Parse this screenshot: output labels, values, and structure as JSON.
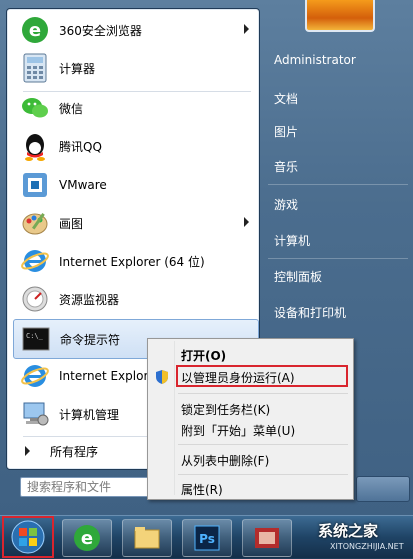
{
  "programs": [
    {
      "label": "360安全浏览器",
      "icon": "360-browser-icon",
      "has_arrow": true
    },
    {
      "label": "计算器",
      "icon": "calculator-icon",
      "has_arrow": false
    },
    {
      "label": "微信",
      "icon": "wechat-icon",
      "has_arrow": false
    },
    {
      "label": "腾讯QQ",
      "icon": "qq-icon",
      "has_arrow": false
    },
    {
      "label": "VMware",
      "icon": "vmware-icon",
      "has_arrow": false
    },
    {
      "label": "画图",
      "icon": "paint-icon",
      "has_arrow": true
    },
    {
      "label": "Internet Explorer (64 位)",
      "icon": "ie-icon",
      "has_arrow": false
    },
    {
      "label": "资源监视器",
      "icon": "resource-monitor-icon",
      "has_arrow": false
    },
    {
      "label": "命令提示符",
      "icon": "cmd-icon",
      "has_arrow": false,
      "highlighted": true
    },
    {
      "label": "Internet Explorer",
      "icon": "ie-icon",
      "has_arrow": false
    },
    {
      "label": "计算机管理",
      "icon": "computer-management-icon",
      "has_arrow": false
    }
  ],
  "all_programs_label": "所有程序",
  "search_placeholder": "搜索程序和文件",
  "right_pane": {
    "user": "Administrator",
    "items": [
      "文档",
      "图片",
      "音乐",
      "游戏",
      "计算机",
      "控制面板",
      "设备和打印机"
    ]
  },
  "context_menu": {
    "open": "打开(O)",
    "run_as_admin": "以管理员身份运行(A)",
    "pin_taskbar": "锁定到任务栏(K)",
    "pin_start": "附到「开始」菜单(U)",
    "remove_list": "从列表中删除(F)",
    "properties": "属性(R)"
  },
  "watermark": {
    "title": "系统之家",
    "sub": "XITONGZHIJIA.NET"
  },
  "colors": {
    "highlight_box": "#d9252e",
    "taskbar": "#1f4466"
  }
}
